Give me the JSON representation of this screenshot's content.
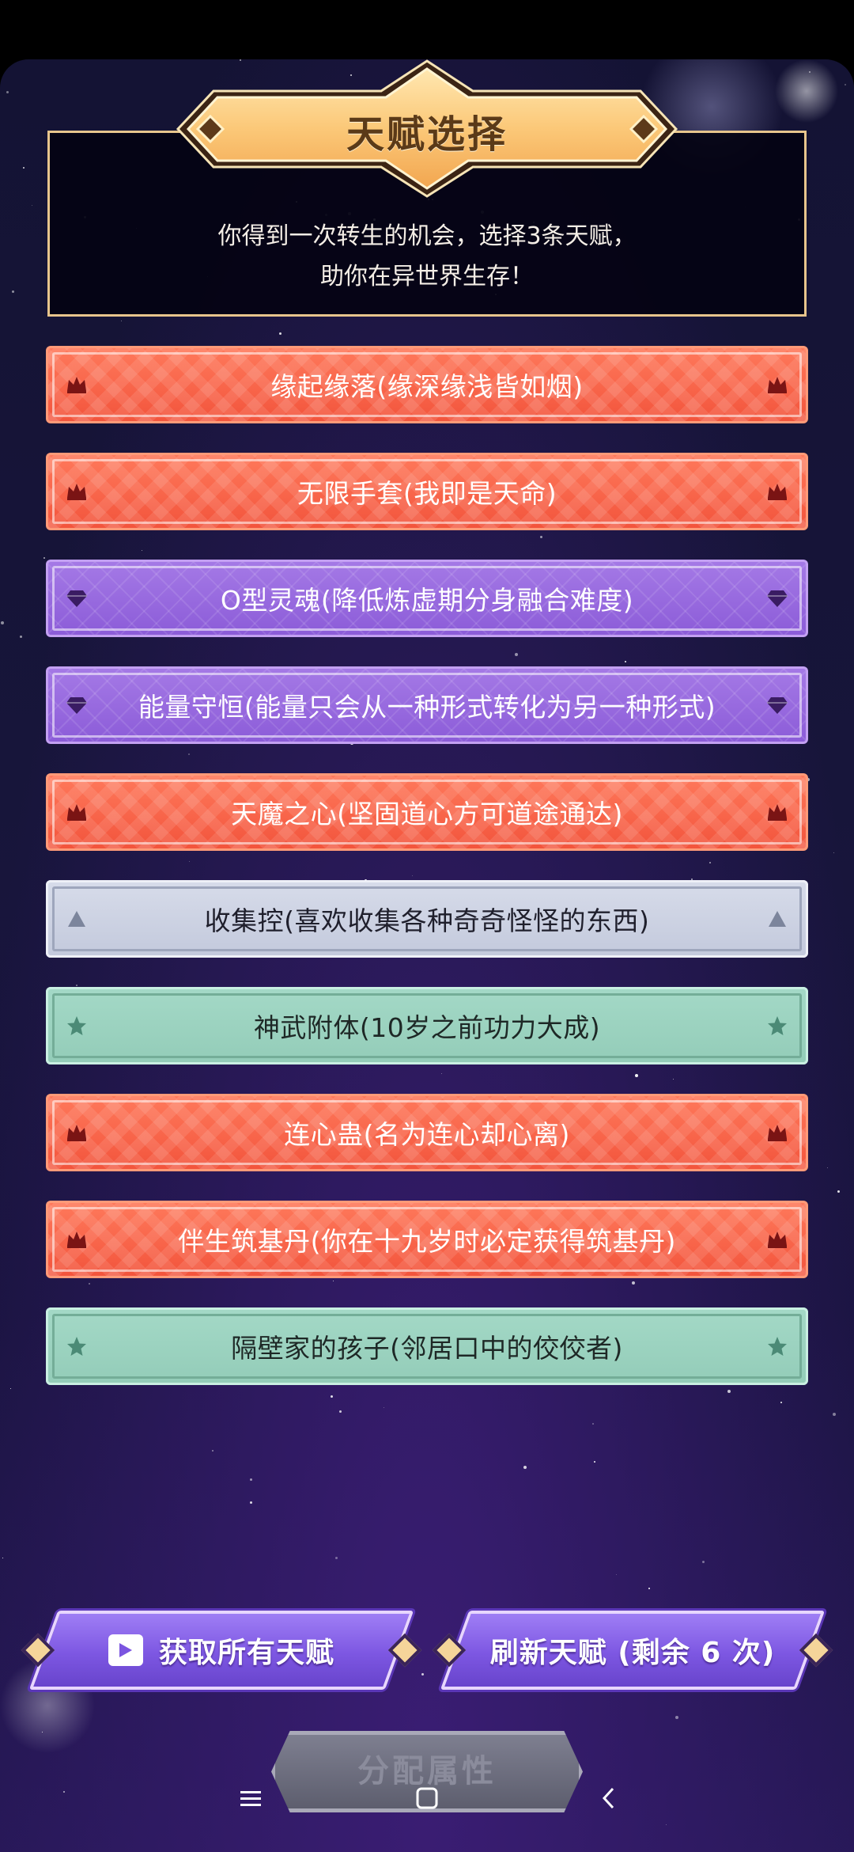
{
  "header": {
    "title": "天赋选择",
    "line1": "你得到一次转生的机会，选择3条天赋，",
    "line2": "助你在异世界生存！"
  },
  "talents": [
    {
      "label": "缘起缘落(缘深缘浅皆如烟)",
      "tier": "red",
      "icon": "crown-icon"
    },
    {
      "label": "无限手套(我即是天命)",
      "tier": "red",
      "icon": "crown-icon"
    },
    {
      "label": "O型灵魂(降低炼虚期分身融合难度)",
      "tier": "purple",
      "icon": "gem-icon"
    },
    {
      "label": "能量守恒(能量只会从一种形式转化为另一种形式)",
      "tier": "purple",
      "icon": "gem-icon"
    },
    {
      "label": "天魔之心(坚固道心方可道途通达)",
      "tier": "red",
      "icon": "crown-icon"
    },
    {
      "label": "收集控(喜欢收集各种奇奇怪怪的东西)",
      "tier": "silver",
      "icon": "triangle-icon"
    },
    {
      "label": "神武附体(10岁之前功力大成)",
      "tier": "green",
      "icon": "star-icon"
    },
    {
      "label": "连心蛊(名为连心却心离)",
      "tier": "red",
      "icon": "crown-icon"
    },
    {
      "label": "伴生筑基丹(你在十九岁时必定获得筑基丹)",
      "tier": "red",
      "icon": "crown-icon"
    },
    {
      "label": "隔壁家的孩子(邻居口中的佼佼者)",
      "tier": "green",
      "icon": "star-icon"
    }
  ],
  "buttons": {
    "get_all": "获取所有天赋",
    "refresh": "刷新天赋 (剩余 6 次)",
    "assign": "分配属性"
  },
  "colors": {
    "red_tier": "#f2533b",
    "purple_tier": "#8b5bd8",
    "silver_tier": "#c3c9dc",
    "green_tier": "#93ccb8",
    "gold_border": "#e7c58c"
  }
}
